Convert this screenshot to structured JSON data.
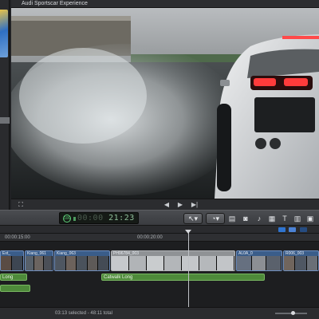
{
  "viewer": {
    "title": "Audi Sportscar Experience",
    "controls": {
      "fit": "⛶",
      "prev": "◀",
      "play": "▶",
      "next": "▶|"
    }
  },
  "toolbar": {
    "timecode": "21:23",
    "timecode_prefix": "00:00",
    "timecode_ring": "100",
    "tools": [
      "select",
      "retime",
      "import",
      "camera",
      "share",
      "transitions",
      "titles",
      "generators",
      "themes"
    ]
  },
  "timeline": {
    "ruler": [
      "00:00:15:00",
      "00:00:20:00"
    ],
    "clips": [
      {
        "label": "Ext_"
      },
      {
        "label": "Kiang_061"
      },
      {
        "label": "Kiang_063"
      },
      {
        "label": "PH96784_003"
      },
      {
        "label": "AL0A_0"
      },
      {
        "label": "R006_003"
      }
    ],
    "audio": [
      {
        "label": "Long"
      },
      {
        "label": "Catwalk Long"
      },
      {
        "label": ""
      }
    ]
  },
  "status": {
    "selection": "03:13 selected - 48:11 total"
  },
  "colors": {
    "accent": "#2f74d0",
    "clip": "#3a5d8a",
    "audio": "#4e8a3a"
  }
}
